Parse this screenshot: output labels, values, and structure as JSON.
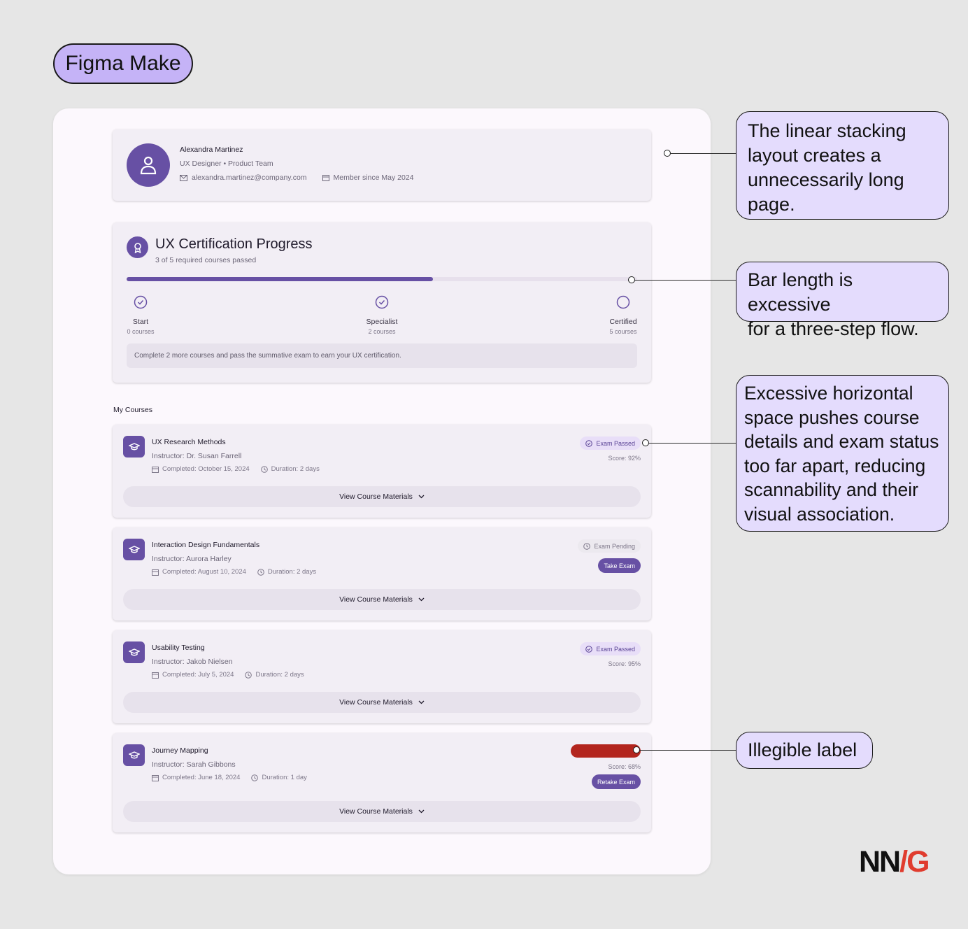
{
  "tag": "Figma Make",
  "profile": {
    "name": "Alexandra Martinez",
    "role": "UX Designer • Product Team",
    "email": "alexandra.martinez@company.com",
    "member_since": "Member since May 2024"
  },
  "certification": {
    "title": "UX Certification Progress",
    "subtitle": "3 of 5 required courses passed",
    "progress_fraction": 0.6,
    "steps": [
      {
        "label": "Start",
        "count": "0 courses",
        "done": true
      },
      {
        "label": "Specialist",
        "count": "2 courses",
        "done": true
      },
      {
        "label": "Certified",
        "count": "5 courses",
        "done": false
      }
    ],
    "note": "Complete 2 more courses and pass the summative exam to earn your UX certification."
  },
  "courses_section_title": "My Courses",
  "courses": [
    {
      "title": "UX Research Methods",
      "instructor": "Instructor: Dr. Susan Farrell",
      "completed": "Completed: October 15, 2024",
      "duration": "Duration: 2 days",
      "status": "Exam Passed",
      "score": "Score: 92%",
      "action": "",
      "view_label": "View Course Materials"
    },
    {
      "title": "Interaction Design Fundamentals",
      "instructor": "Instructor: Aurora Harley",
      "completed": "Completed: August 10, 2024",
      "duration": "Duration: 2 days",
      "status": "Exam Pending",
      "score": "",
      "action": "Take Exam",
      "view_label": "View Course Materials"
    },
    {
      "title": "Usability Testing",
      "instructor": "Instructor: Jakob Nielsen",
      "completed": "Completed: July 5, 2024",
      "duration": "Duration: 2 days",
      "status": "Exam Passed",
      "score": "Score: 95%",
      "action": "",
      "view_label": "View Course Materials"
    },
    {
      "title": "Journey Mapping",
      "instructor": "Instructor: Sarah Gibbons",
      "completed": "Completed: June 18, 2024",
      "duration": "Duration: 1 day",
      "status": "",
      "score": "Score: 68%",
      "action": "Retake Exam",
      "view_label": "View Course Materials"
    }
  ],
  "callouts": {
    "c1": [
      "The linear stacking",
      "layout creates a",
      "unnecessarily long",
      "page."
    ],
    "c2": [
      "Bar length is excessive",
      "for a three-step flow."
    ],
    "c3": [
      "Excessive horizontal",
      "space pushes course",
      "details and exam status",
      "too far apart, reducing",
      "scannability and their",
      "visual association."
    ],
    "c4": [
      "Illegible label"
    ]
  },
  "logo": {
    "nn": "NN",
    "slash": "/",
    "g": "G"
  },
  "colors": {
    "accent": "#6750a4",
    "failed": "#b3251e",
    "callout_bg": "#e4dcfd",
    "tag_bg": "#c5b3f7"
  }
}
